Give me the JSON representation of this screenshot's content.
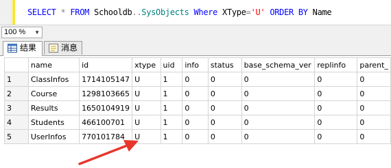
{
  "editor": {
    "sql_select": "SELECT",
    "sql_star": "*",
    "sql_from": "FROM",
    "sql_db": "Schooldb",
    "sql_dots": "..",
    "sql_table": "SysObjects",
    "sql_where": "Where",
    "sql_col": "XType",
    "sql_eq": "=",
    "sql_val": "'U'",
    "sql_orderby": "ORDER BY",
    "sql_ordercol": "Name"
  },
  "zoom": {
    "value": "100 %"
  },
  "tabs": [
    {
      "label": "结果",
      "icon": "grid-results-icon",
      "active": true
    },
    {
      "label": "消息",
      "icon": "messages-icon",
      "active": false
    }
  ],
  "grid": {
    "columns": [
      "",
      "name",
      "id",
      "xtype",
      "uid",
      "info",
      "status",
      "base_schema_ver",
      "replinfo",
      "parent_"
    ],
    "rows": [
      [
        "1",
        "ClassInfos",
        "1714105147",
        "U",
        "1",
        "0",
        "0",
        "0",
        "0",
        "0"
      ],
      [
        "2",
        "Course",
        "1298103665",
        "U",
        "1",
        "0",
        "0",
        "0",
        "0",
        "0"
      ],
      [
        "3",
        "Results",
        "1650104919",
        "U",
        "1",
        "0",
        "0",
        "0",
        "0",
        "0"
      ],
      [
        "4",
        "Students",
        "466100701",
        "U",
        "1",
        "0",
        "0",
        "0",
        "0",
        "0"
      ],
      [
        "5",
        "UserInfos",
        "770101784",
        "U",
        "1",
        "0",
        "0",
        "0",
        "0",
        "0"
      ]
    ]
  },
  "annotation": {
    "icon": "red-arrow-icon",
    "color": "#e8362c"
  }
}
